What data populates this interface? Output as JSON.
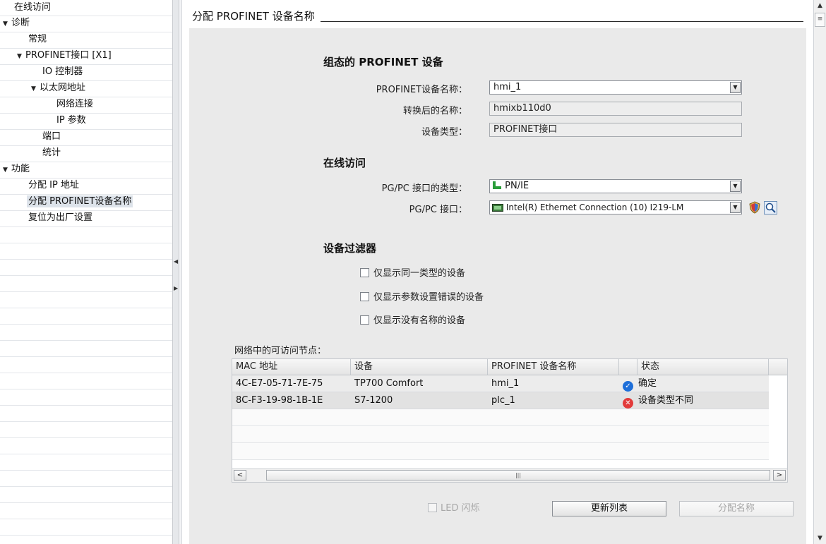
{
  "nav": {
    "items": [
      {
        "label": "在线访问",
        "toggle": ""
      },
      {
        "label": "诊断",
        "toggle": "▼"
      },
      {
        "label": "常规",
        "toggle": ""
      },
      {
        "label": "PROFINET接口 [X1]",
        "toggle": "▼"
      },
      {
        "label": "IO 控制器",
        "toggle": ""
      },
      {
        "label": "以太网地址",
        "toggle": "▼"
      },
      {
        "label": "网络连接",
        "toggle": ""
      },
      {
        "label": "IP 参数",
        "toggle": ""
      },
      {
        "label": "端口",
        "toggle": ""
      },
      {
        "label": "统计",
        "toggle": ""
      },
      {
        "label": "功能",
        "toggle": "▼"
      },
      {
        "label": "分配 IP 地址",
        "toggle": ""
      },
      {
        "label": "分配 PROFINET设备名称",
        "toggle": ""
      },
      {
        "label": "复位为出厂设置",
        "toggle": ""
      }
    ]
  },
  "section": {
    "title": "分配 PROFINET 设备名称"
  },
  "configured": {
    "heading": "组态的 PROFINET 设备",
    "device_name_label": "PROFINET设备名称：",
    "device_name_value": "hmi_1",
    "converted_name_label": "转换后的名称：",
    "converted_name_value": "hmixb110d0",
    "device_type_label": "设备类型：",
    "device_type_value": "PROFINET接口"
  },
  "online": {
    "heading": "在线访问",
    "iface_type_label": "PG/PC 接口的类型：",
    "iface_type_value": "PN/IE",
    "iface_label": "PG/PC 接口：",
    "iface_value": "Intel(R) Ethernet Connection (10) I219-LM"
  },
  "filter": {
    "heading": "设备过滤器",
    "options": [
      {
        "label": "仅显示同一类型的设备",
        "checked": false
      },
      {
        "label": "仅显示参数设置错误的设备",
        "checked": false
      },
      {
        "label": "仅显示没有名称的设备",
        "checked": false
      }
    ]
  },
  "nodes": {
    "label": "网络中的可访问节点：",
    "columns": [
      "MAC 地址",
      "设备",
      "PROFINET 设备名称",
      "",
      "状态"
    ],
    "rows": [
      {
        "mac": "4C-E7-05-71-7E-75",
        "device": "TP700 Comfort",
        "name": "hmi_1",
        "status": "确定",
        "status_icon": "check-icon"
      },
      {
        "mac": "8C-F3-19-98-1B-1E",
        "device": "S7-1200",
        "name": "plc_1",
        "status": "设备类型不同",
        "status_icon": "error-icon"
      }
    ]
  },
  "actions": {
    "led_label": "LED 闪烁",
    "update_label": "更新列表",
    "assign_label": "分配名称"
  },
  "colors": {
    "panel_bg": "#eaeaea",
    "ok": "#1e6fd9",
    "error": "#e23a3a",
    "pn_green": "#2a9d3a"
  }
}
